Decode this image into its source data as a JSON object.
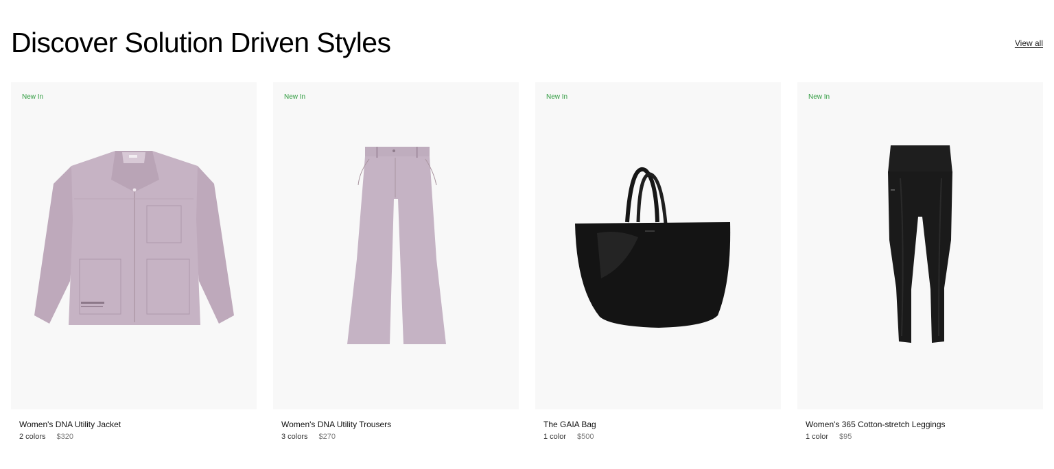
{
  "section": {
    "title": "Discover Solution Driven Styles",
    "view_all": "View all"
  },
  "colors": {
    "badge_green": "#2e9b3e",
    "card_background": "#f8f8f8",
    "lilac": "#c4b1c2",
    "black_product": "#1a1a1a"
  },
  "products": [
    {
      "badge": "New In",
      "name": "Women's DNA Utility Jacket",
      "colors": "2 colors",
      "price": "$320",
      "icon": "jacket-icon"
    },
    {
      "badge": "New In",
      "name": "Women's DNA Utility Trousers",
      "colors": "3 colors",
      "price": "$270",
      "icon": "trousers-icon"
    },
    {
      "badge": "New In",
      "name": "The GAIA Bag",
      "colors": "1 color",
      "price": "$500",
      "icon": "tote-bag-icon"
    },
    {
      "badge": "New In",
      "name": "Women's 365 Cotton-stretch Leggings",
      "colors": "1 color",
      "price": "$95",
      "icon": "leggings-icon"
    }
  ]
}
